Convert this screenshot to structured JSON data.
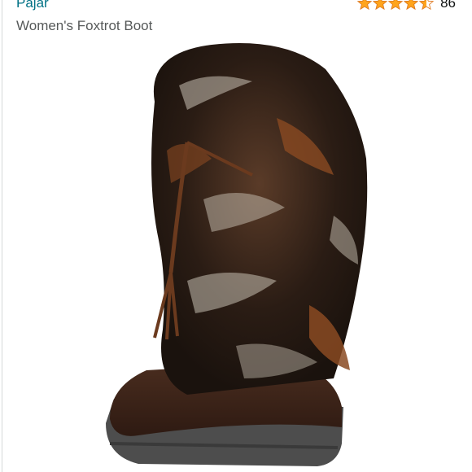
{
  "listing": {
    "brand": "Pajar",
    "title": "Women's Foxtrot Boot",
    "rating": {
      "value": 4.5,
      "max": 5,
      "count": "86",
      "star_color": "#ffa41c"
    }
  },
  "image": {
    "subject": "fur-boot-icon",
    "colors": {
      "fur_dark": "#2a1c14",
      "fur_rust": "#8a4a22",
      "fur_silver": "#c9c1b4",
      "leather": "#3a2319",
      "sole": "#4d4d4d",
      "tassel": "#6b3a1e"
    }
  }
}
